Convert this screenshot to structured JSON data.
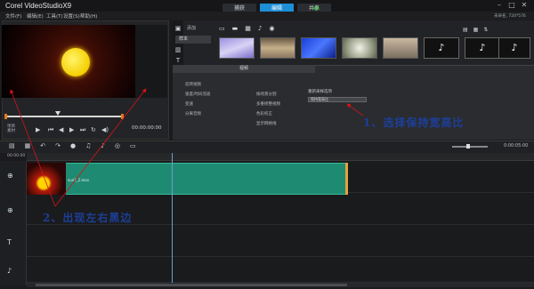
{
  "app": {
    "title": "Corel VideoStudioX9"
  },
  "menus": [
    "文件(F)",
    "编辑(E)",
    "工具(T)",
    "设置(S)",
    "帮助(H)"
  ],
  "tabs": [
    {
      "label": "捕获"
    },
    {
      "label": "编辑"
    },
    {
      "label": "共享"
    }
  ],
  "active_tab": "编辑",
  "status_right": "未命名, 720*576",
  "player": {
    "modes": [
      "项目",
      "素材"
    ],
    "timecode": "00:00:00:00"
  },
  "library": {
    "add_label": "添加",
    "folder_label": "样本"
  },
  "options": {
    "header": "视频",
    "aspect_label": "重新采样选项",
    "aspect_value": "保持宽高比",
    "rows": [
      "反转视频",
      "速度/时间流逝",
      "变速",
      "分离音频",
      "按场景分割",
      "多重修整视频",
      "色彩校正",
      "显示网格线"
    ]
  },
  "timeline": {
    "ruler_label": "00:00:00",
    "time_right": "0:00:05:00",
    "clip_name": "sun1_2.mov"
  },
  "annotations": {
    "note1": "1、选择保持宽高比",
    "note2": "2、出现左右黑边"
  },
  "colors": {
    "accent": "#1d8fd6",
    "clip": "#1f8a72",
    "annotation": "#1d3f9a"
  }
}
